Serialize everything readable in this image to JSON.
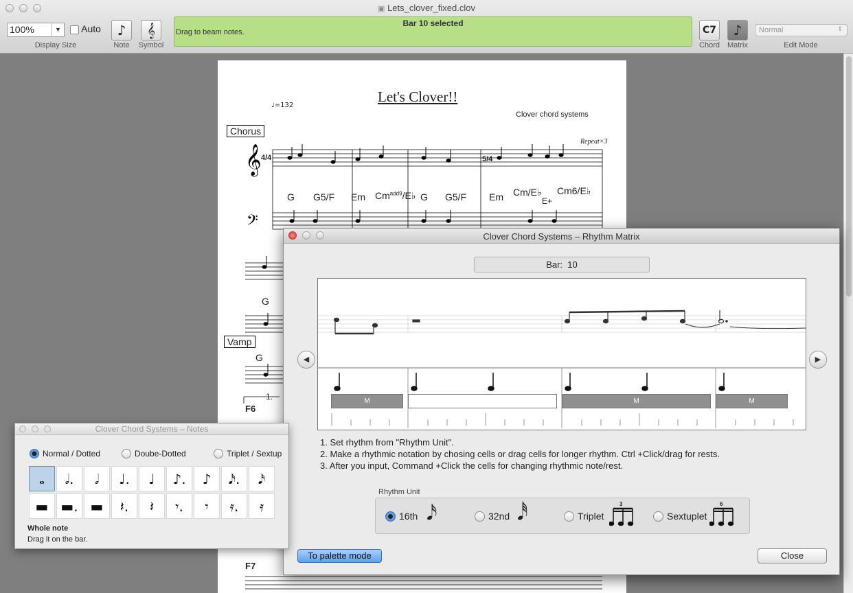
{
  "window": {
    "title": "Lets_clover_fixed.clov"
  },
  "toolbar": {
    "zoom_value": "100%",
    "auto_label": "Auto",
    "display_size_caption": "Display Size",
    "note_caption": "Note",
    "symbol_caption": "Symbol",
    "status_title": "Bar 10 selected",
    "status_message": "Drag to beam notes.",
    "chord_button": "C7",
    "chord_caption": "Chord",
    "matrix_caption": "Matrix",
    "edit_mode_value": "Normal",
    "edit_mode_caption": "Edit Mode"
  },
  "score": {
    "title": "Let's Clover!!",
    "composer": "Clover chord systems",
    "tempo": "♩=132",
    "repeat": "Repeat×3",
    "section_chorus": "Chorus",
    "section_vamp": "Vamp",
    "chords_row1": [
      "G",
      "G5/F",
      "Em",
      "Cm",
      "G",
      "G5/F",
      "Em",
      "Cm/E♭",
      "Cm6/E♭"
    ],
    "chord_add9": "add9",
    "chord_e_flat": "E♭",
    "chord_eplus": "E+",
    "chord_g_sys2": "G",
    "chord_vamp_g": "G",
    "ending": "1.",
    "chord_f6": "F6",
    "chord_f7": "F7",
    "time_sig_a": "4/4",
    "time_sig_b": "5/4"
  },
  "matrix_window": {
    "title": "Clover Chord Systems – Rhythm Matrix",
    "bar_label": "Bar:",
    "bar_number": "10",
    "cell_marker": "M",
    "instructions": [
      "1. Set rhythm from \"Rhythm Unit\".",
      "2. Make a rhythmic notation by chosing cells or drag cells for longer rhythm. Ctrl +Click/drag for rests.",
      "3.  After you input, Command +Click the cells for changing rhythmic note/rest."
    ],
    "rhythm_unit_caption": "Rhythm Unit",
    "rhythm_units": [
      "16th",
      "32nd",
      "Triplet",
      "Sextuplet"
    ],
    "selected_unit": "16th",
    "triplet_number": "3",
    "sextuplet_number": "6",
    "palette_button": "To palette mode",
    "close_button": "Close"
  },
  "notes_window": {
    "title": "Clover Chord Systems – Notes",
    "modes": [
      "Normal / Dotted",
      "Doube-Dotted",
      "Triplet / Sextup"
    ],
    "selected_mode": "Normal / Dotted",
    "notes_row": [
      "𝅝",
      "𝅗𝅥.",
      "𝅗𝅥",
      "♩.",
      "♩",
      "♪.",
      "♪",
      "𝅘𝅥𝅯.",
      "𝅘𝅥𝅯"
    ],
    "rests_row": [
      "▬",
      "▬.",
      "▬",
      "𝄽.",
      "𝄽",
      "𝄾.",
      "𝄾",
      "𝄿.",
      "𝄿"
    ],
    "selected_name": "Whole note",
    "hint": "Drag it on the bar."
  }
}
